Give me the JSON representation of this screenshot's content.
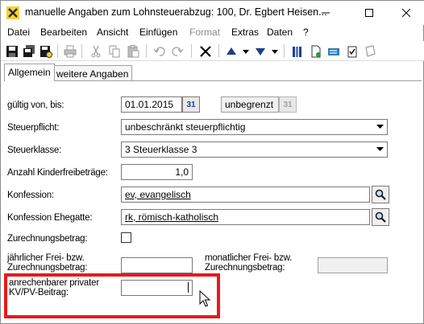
{
  "window": {
    "title": "manuelle Angaben zum Lohnsteuerabzug: 100, Dr. Egbert Heisen..."
  },
  "menu": {
    "datei": "Datei",
    "bearbeiten": "Bearbeiten",
    "ansicht": "Ansicht",
    "einfuegen": "Einfügen",
    "format": "Format",
    "extras": "Extras",
    "daten": "Daten",
    "help": "?"
  },
  "tabs": {
    "allgemein": "Allgemein",
    "weitere": "weitere Angaben"
  },
  "form": {
    "gueltig_label": "gültig von, bis:",
    "gueltig_von": "01.01.2015",
    "gueltig_bis": "unbegrenzt",
    "calendar_glyph": "31",
    "steuerpflicht_label": "Steuerpflicht:",
    "steuerpflicht_value": "unbeschränkt steuerpflichtig",
    "steuerklasse_label": "Steuerklasse:",
    "steuerklasse_value": "3  Steuerklasse 3",
    "kinderfreibetraege_label": "Anzahl Kinderfreibeträge:",
    "kinderfreibetraege_value": "1,0",
    "konfession_label": "Konfession:",
    "konfession_value": "ev, evangelisch",
    "konfession_ehegatte_label": "Konfession Ehegatte:",
    "konfession_ehegatte_value": "rk, römisch-katholisch",
    "zurechnungsbetrag_label": "Zurechnungsbetrag:",
    "jaehrlicher_label": "jährlicher Frei- bzw. Zurechnungsbetrag:",
    "jaehrlicher_value": "",
    "monatlicher_label": "monatlicher Frei- bzw. Zurechnungsbetrag:",
    "monatlicher_value": "",
    "kvpv_label": "anrechenbarer privater KV/PV-Beitrag:",
    "kvpv_value": ""
  },
  "colors": {
    "highlight": "#e8191c",
    "accent_blue": "#1e3f8a"
  }
}
